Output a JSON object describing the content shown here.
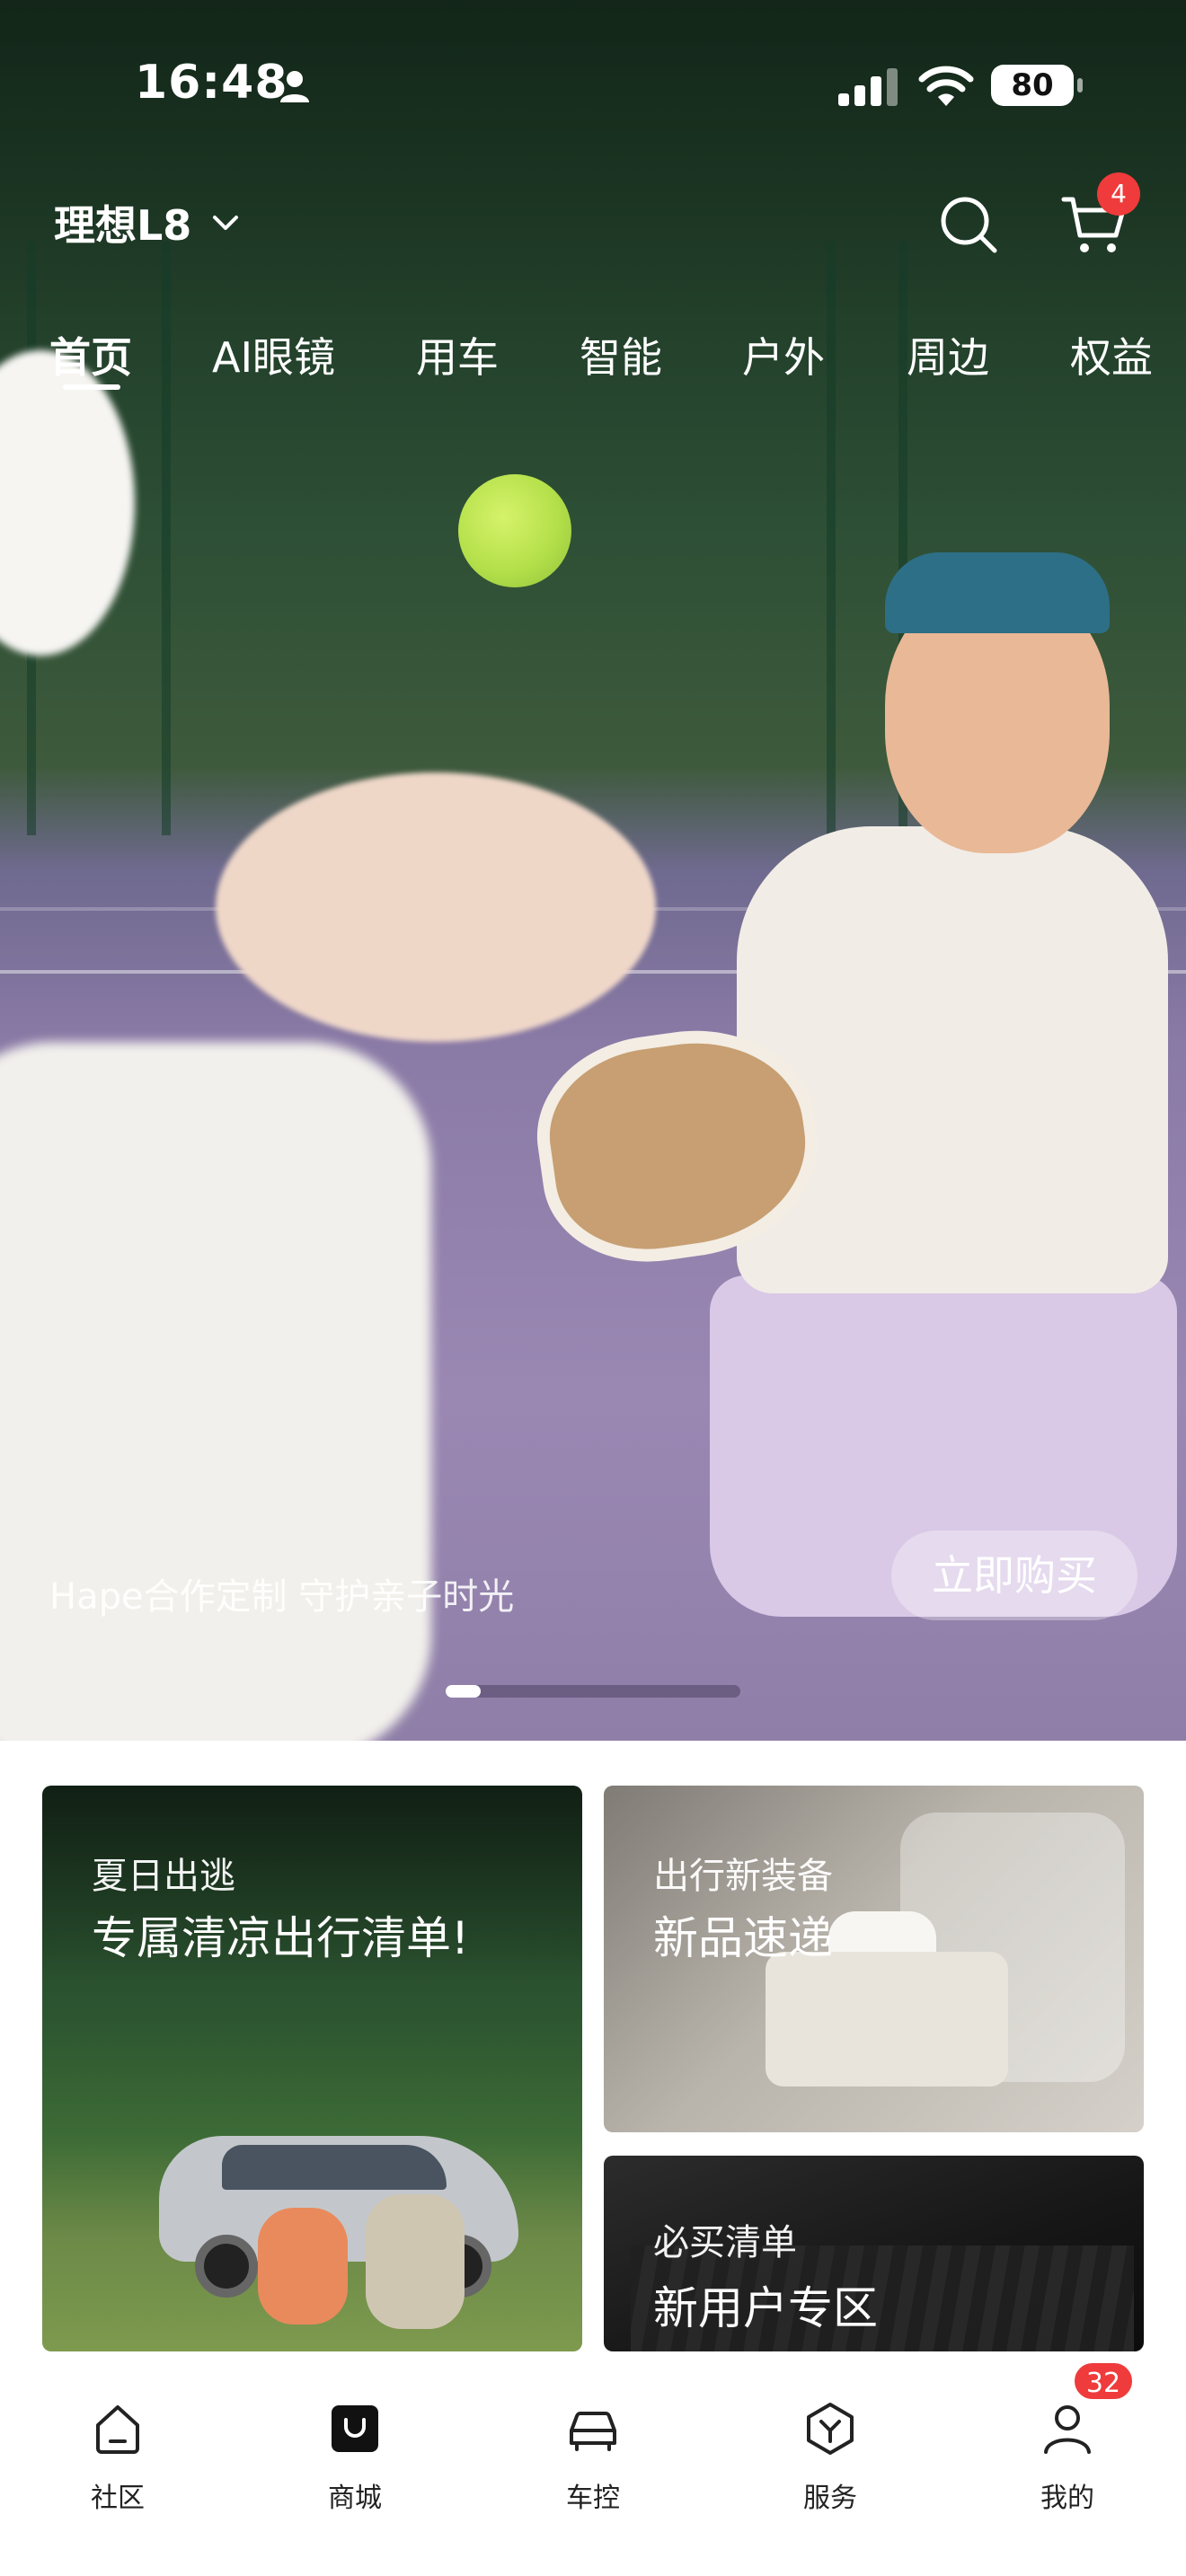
{
  "status_bar": {
    "time": "16:48",
    "battery": "80"
  },
  "header": {
    "model": "理想L8",
    "cart_count": "4"
  },
  "category_tabs": [
    "首页",
    "AI眼镜",
    "用车",
    "智能",
    "户外",
    "周边",
    "权益"
  ],
  "hero": {
    "caption": "Hape合作定制 守护亲子时光",
    "button_label": "立即购买",
    "carousel_progress": 0.12
  },
  "cards": {
    "summer": {
      "kicker": "夏日出逃",
      "headline": "专属清凉出行清单!"
    },
    "new": {
      "kicker": "出行新装备",
      "headline": "新品速递"
    },
    "must": {
      "kicker": "必买清单",
      "headline": "新用户专区"
    }
  },
  "tab_bar": {
    "items": [
      {
        "label": "社区",
        "icon": "community-icon"
      },
      {
        "label": "商城",
        "icon": "shop-bag-icon"
      },
      {
        "label": "车控",
        "icon": "car-control-icon"
      },
      {
        "label": "服务",
        "icon": "service-icon"
      },
      {
        "label": "我的",
        "icon": "profile-icon"
      }
    ],
    "mine_badge": "32"
  },
  "colors": {
    "badge": "#ef3b3b",
    "accent_white": "#ffffff"
  }
}
